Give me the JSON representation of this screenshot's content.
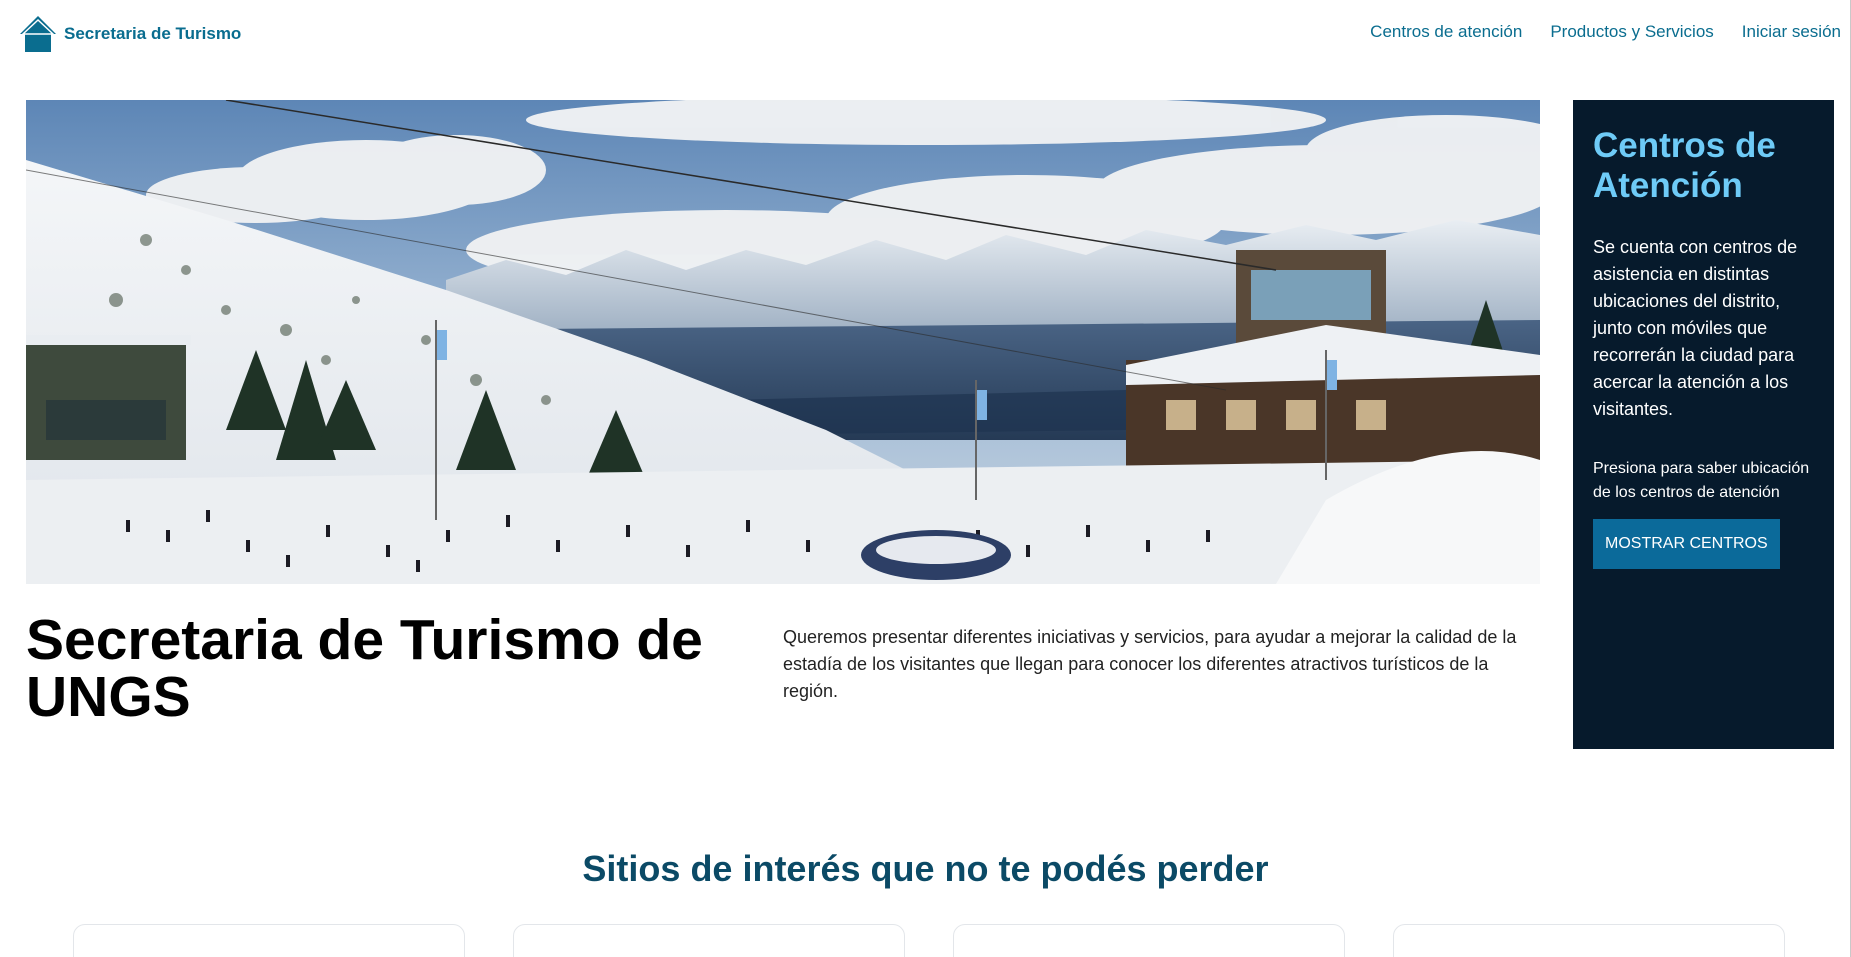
{
  "nav": {
    "brand": "Secretaria de Turismo",
    "links": [
      "Centros de atención",
      "Productos y Servicios",
      "Iniciar sesión"
    ]
  },
  "hero": {
    "title": "Secretaria de Turismo de UNGS",
    "description": "Queremos presentar diferentes iniciativas y servicios, para ayudar a mejorar la calidad de la estadía de los visitantes que llegan para conocer los diferentes atractivos turísticos de la región."
  },
  "sidebar": {
    "title": "Centros de Atención",
    "text": "Se cuenta con centros de asistencia en distintas ubicaciones del distrito, junto con móviles que recorrerán la ciudad para acercar la atención a los visitantes.",
    "hint": "Presiona para saber ubicación de los centros de atención",
    "button": "MOSTRAR CENTROS"
  },
  "section": {
    "title": "Sitios de interés que no te podés perder"
  },
  "colors": {
    "brand": "#0a6d8f",
    "sidebar_bg": "#061a2c",
    "sidebar_title": "#6ecbf7",
    "button": "#0b6a9a",
    "section_title": "#0b4a66"
  }
}
